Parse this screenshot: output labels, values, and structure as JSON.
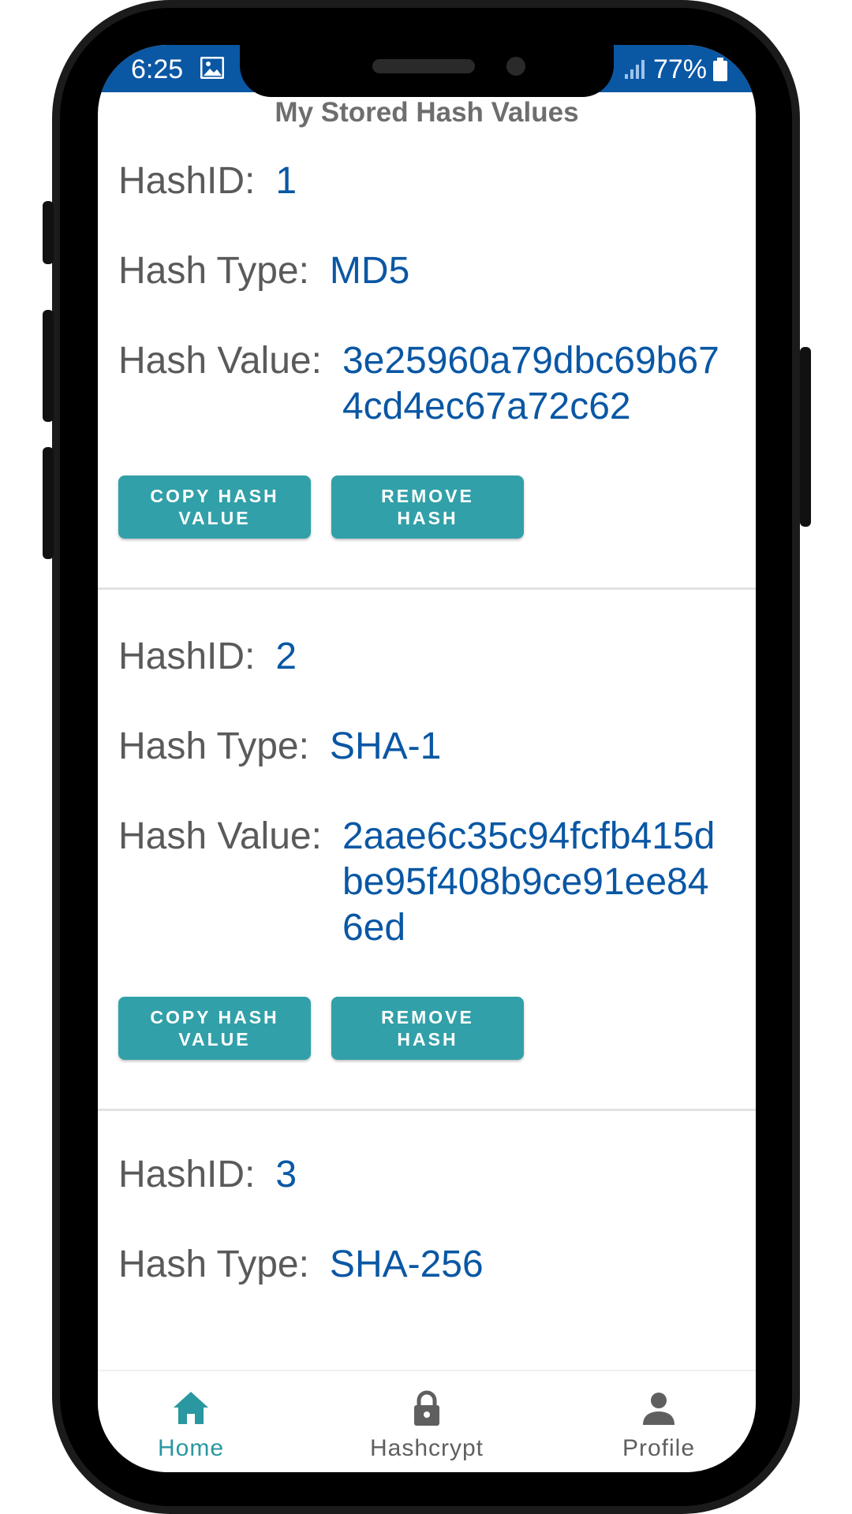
{
  "status_bar": {
    "time": "6:25",
    "battery": "77%",
    "background_color": "#0a57a4"
  },
  "header": {
    "title": "My Stored Hash Values"
  },
  "labels": {
    "hash_id": "HashID:",
    "hash_type": "Hash Type:",
    "hash_value": "Hash Value:"
  },
  "buttons": {
    "copy": "COPY HASH\nVALUE",
    "remove": "REMOVE\nHASH",
    "color": "#32a0a8"
  },
  "hashes": [
    {
      "id": "1",
      "type": "MD5",
      "value": "3e25960a79dbc69b674cd4ec67a72c62"
    },
    {
      "id": "2",
      "type": "SHA-1",
      "value": "2aae6c35c94fcfb415dbe95f408b9ce91ee846ed"
    },
    {
      "id": "3",
      "type": "SHA-256"
    }
  ],
  "bottom_nav": {
    "items": [
      {
        "label": "Home",
        "icon": "home-icon",
        "active": true
      },
      {
        "label": "Hashcrypt",
        "icon": "lock-icon",
        "active": false
      },
      {
        "label": "Profile",
        "icon": "person-icon",
        "active": false
      }
    ],
    "active_color": "#2a97a1",
    "inactive_color": "#5f5f5f"
  }
}
